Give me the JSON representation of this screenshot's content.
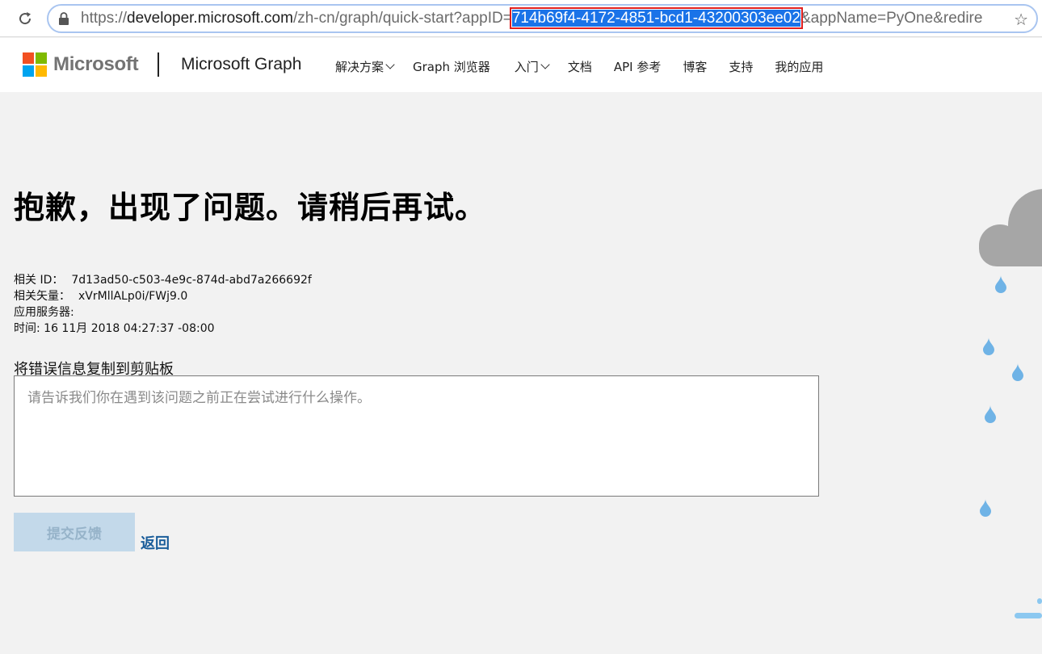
{
  "browser": {
    "url_prefix": "https://",
    "url_host": "developer.microsoft.com",
    "url_path": "/zh-cn/graph/quick-start?appID=",
    "url_selected": "714b69f4-4172-4851-bcd1-43200303ee02",
    "url_suffix": "&appName=PyOne&redire"
  },
  "header": {
    "logo_text": "Microsoft",
    "product": "Microsoft Graph",
    "nav": [
      {
        "label": "解决方案",
        "dropdown": true
      },
      {
        "label": "Graph 浏览器",
        "dropdown": false
      },
      {
        "label": "入门",
        "dropdown": true
      },
      {
        "label": "文档",
        "dropdown": false
      },
      {
        "label": "API 参考",
        "dropdown": false
      },
      {
        "label": "博客",
        "dropdown": false
      },
      {
        "label": "支持",
        "dropdown": false
      },
      {
        "label": "我的应用",
        "dropdown": false
      }
    ]
  },
  "error": {
    "title": "抱歉，出现了问题。请稍后再试。",
    "correlation_label": "相关 ID：",
    "correlation_value": "7d13ad50-c503-4e9c-874d-abd7a266692f",
    "vector_label": "相关矢量：",
    "vector_value": "xVrMllALp0i/FWj9.0",
    "server_label": "应用服务器:",
    "time_label": "时间:",
    "time_value": "16 11月 2018 04:27:37 -08:00",
    "copy_label": "将错误信息复制到剪贴板",
    "feedback_placeholder": "请告诉我们你在遇到该问题之前正在尝试进行什么操作。",
    "submit_label": "提交反馈",
    "back_label": "返回"
  },
  "colors": {
    "accent": "#1a73e8",
    "highlight_box": "#e02020",
    "link": "#1a5d9a",
    "cloud": "#a6a6a6",
    "raindrop": "#6fb3e6",
    "ms_red": "#f25022",
    "ms_green": "#7fba00",
    "ms_blue": "#00a4ef",
    "ms_yellow": "#ffb900"
  }
}
